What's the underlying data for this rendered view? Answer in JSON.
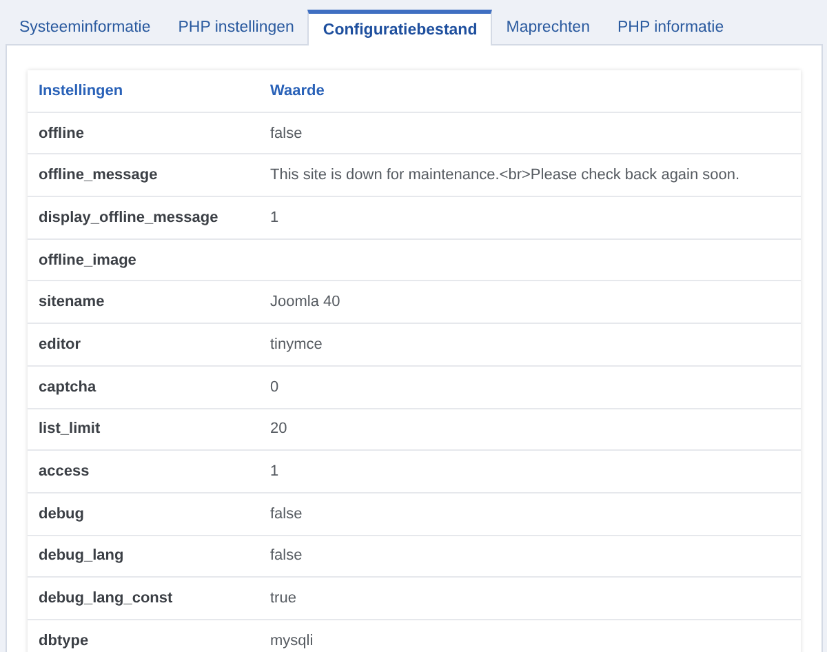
{
  "tabs": [
    {
      "label": "Systeeminformatie",
      "selected": false
    },
    {
      "label": "PHP instellingen",
      "selected": false
    },
    {
      "label": "Configuratiebestand",
      "selected": true
    },
    {
      "label": "Maprechten",
      "selected": false
    },
    {
      "label": "PHP informatie",
      "selected": false
    }
  ],
  "table": {
    "columns": [
      "Instellingen",
      "Waarde"
    ],
    "rows": [
      [
        "offline",
        "false"
      ],
      [
        "offline_message",
        "This site is down for maintenance.<br>Please check back again soon."
      ],
      [
        "display_offline_message",
        "1"
      ],
      [
        "offline_image",
        ""
      ],
      [
        "sitename",
        "Joomla 40"
      ],
      [
        "editor",
        "tinymce"
      ],
      [
        "captcha",
        "0"
      ],
      [
        "list_limit",
        "20"
      ],
      [
        "access",
        "1"
      ],
      [
        "debug",
        "false"
      ],
      [
        "debug_lang",
        "false"
      ],
      [
        "debug_lang_const",
        "true"
      ],
      [
        "dbtype",
        "mysqli"
      ]
    ]
  }
}
